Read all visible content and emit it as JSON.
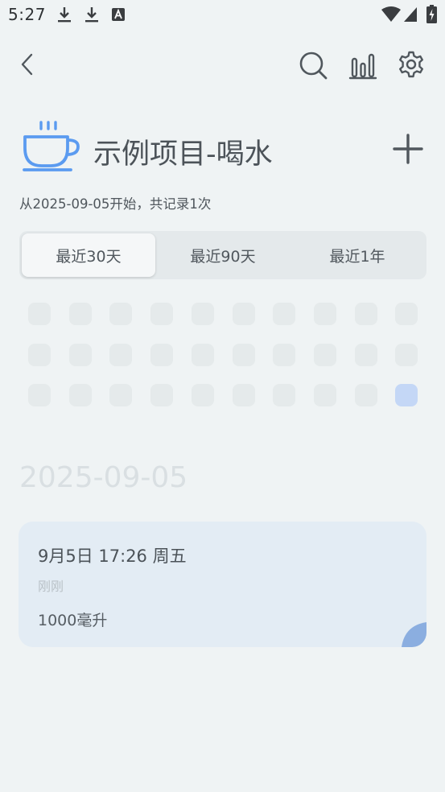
{
  "status_bar": {
    "time": "5:27"
  },
  "header": {
    "project_title": "示例项目-喝水",
    "subtitle": "从2025-09-05开始，共记录1次",
    "project_icon": "coffee-cup-icon",
    "accent_color": "#5b9bf0"
  },
  "tabs": [
    {
      "label": "最近30天",
      "active": true
    },
    {
      "label": "最近90天",
      "active": false
    },
    {
      "label": "最近1年",
      "active": false
    }
  ],
  "heatmap": {
    "rows": 3,
    "cols": 10,
    "filled_cells": [
      29
    ],
    "empty_color": "#e5eaeb",
    "filled_color": "#c4d7f6"
  },
  "date_heading": "2025-09-05",
  "record": {
    "time": "9月5日 17:26 周五",
    "relative": "刚刚",
    "amount": "1000毫升"
  }
}
